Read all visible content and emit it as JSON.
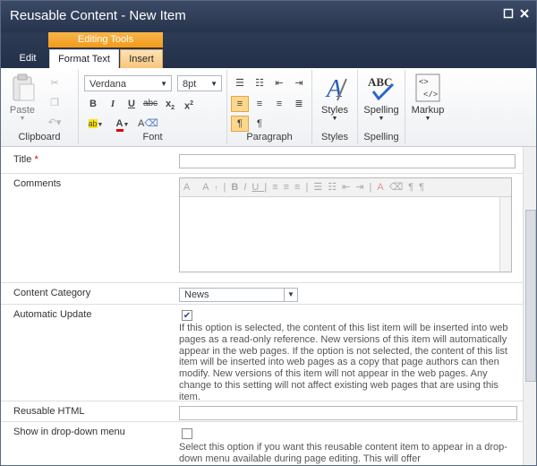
{
  "window": {
    "title": "Reusable Content - New Item"
  },
  "ribbon": {
    "context_header": "Editing Tools",
    "tabs": [
      "Edit",
      "Format Text",
      "Insert"
    ],
    "clipboard": {
      "paste_label": "Paste",
      "group_label": "Clipboard"
    },
    "font": {
      "family": "Verdana",
      "size": "8pt",
      "group_label": "Font"
    },
    "paragraph": {
      "group_label": "Paragraph"
    },
    "styles": {
      "button_label": "Styles",
      "group_label": "Styles"
    },
    "spelling": {
      "button_label": "Spelling",
      "abc": "ABC",
      "group_label": "Spelling"
    },
    "markup": {
      "button_label": "Markup"
    }
  },
  "form": {
    "title_label": "Title",
    "required_mark": "*",
    "comments_label": "Comments",
    "content_category_label": "Content Category",
    "content_category_value": "News",
    "automatic_update_label": "Automatic Update",
    "automatic_update_checked": true,
    "automatic_update_help": "If this option is selected, the content of this list item will be inserted into web pages as a read-only reference. New versions of this item will automatically appear in the web pages. If the option is not selected, the content of this list item will be inserted into web pages as a copy that page authors can then modify. New versions of this item will not appear in the web pages. Any change to this setting will not affect existing web pages that are using this item.",
    "reusable_html_label": "Reusable HTML",
    "show_in_dropdown_label": "Show in drop-down menu",
    "show_in_dropdown_checked": false,
    "show_in_dropdown_help": "Select this option if you want this reusable content item to appear in a drop-down menu available during page editing. This will offer"
  }
}
